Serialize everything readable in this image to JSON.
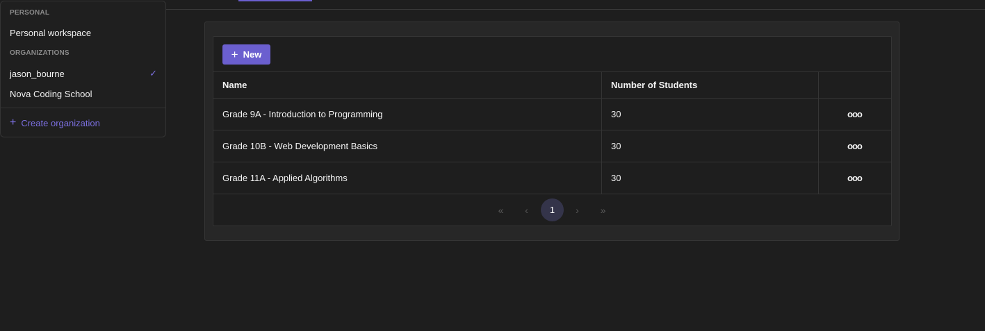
{
  "dropdown": {
    "personal_label": "PERSONAL",
    "personal_workspace": "Personal workspace",
    "orgs_label": "ORGANIZATIONS",
    "orgs": [
      {
        "name": "jason_bourne",
        "selected": true
      },
      {
        "name": "Nova Coding School",
        "selected": false
      }
    ],
    "check_glyph": "✓",
    "create_label": "Create organization",
    "create_icon": "plus-icon"
  },
  "toolbar": {
    "new_label": "New",
    "new_icon": "plus-icon"
  },
  "table": {
    "columns": [
      "Name",
      "Number of Students",
      ""
    ],
    "rows": [
      {
        "name": "Grade 9A - Introduction to Programming",
        "students": "30",
        "actions": "ooo"
      },
      {
        "name": "Grade 10B - Web Development Basics",
        "students": "30",
        "actions": "ooo"
      },
      {
        "name": "Grade 11A - Applied Algorithms",
        "students": "30",
        "actions": "ooo"
      }
    ]
  },
  "pagination": {
    "first": "«",
    "prev": "‹",
    "page": "1",
    "next": "›",
    "last": "»"
  },
  "colors": {
    "accent": "#6b5fcf",
    "background": "#1e1e1e",
    "panel": "#272727"
  }
}
